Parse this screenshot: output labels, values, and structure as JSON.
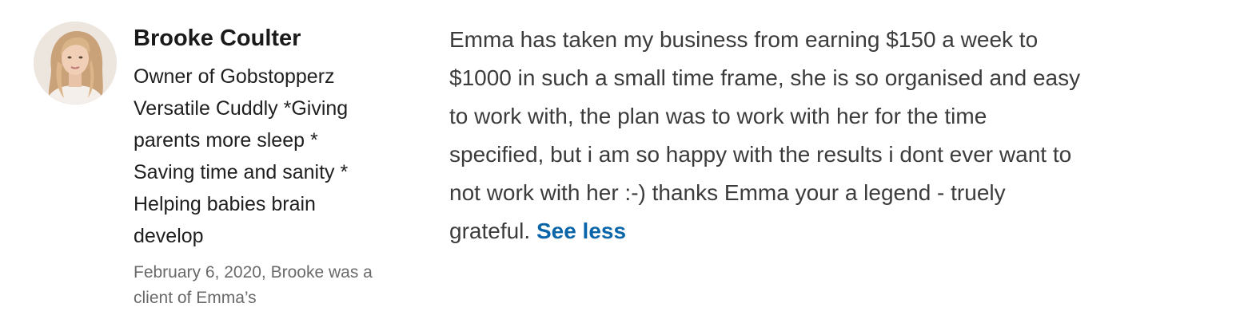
{
  "recommender": {
    "name": "Brooke Coulter",
    "headline_lines": [
      "Owner of Gobstopperz",
      "Versatile Cuddly *Giving",
      "parents more sleep *",
      "Saving time and sanity *",
      "Helping babies brain",
      "develop"
    ],
    "meta_lines": [
      "February 6, 2020, Brooke was a",
      "client of Emma’s"
    ],
    "avatar_icon": "profile-photo"
  },
  "recommendation": {
    "text_lines": [
      "Emma has taken my business from earning $150 a week to",
      "$1000 in such a small time frame, she is so organised and easy",
      "to work with, the plan was to work with her for the time",
      "specified, but i am so happy with the results i dont ever want to",
      "not work with her :-) thanks Emma your a legend - truely",
      "grateful."
    ],
    "toggle_label": "See less"
  },
  "colors": {
    "name": "#1a1a1a",
    "body_text": "#3c3c3c",
    "meta_text": "#6a6a6a",
    "link": "#0a66a8"
  }
}
